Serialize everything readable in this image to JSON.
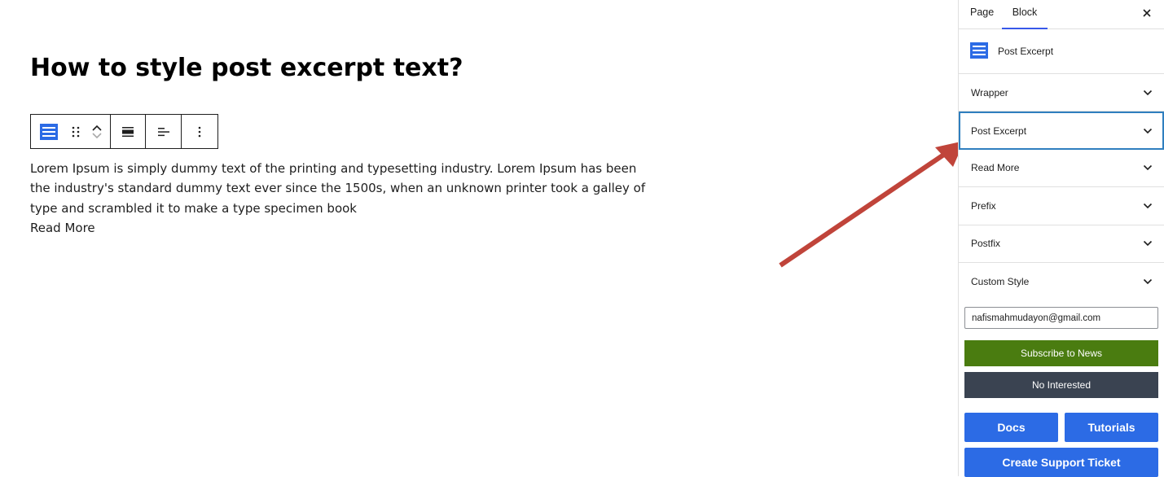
{
  "post": {
    "title": "How to style post excerpt text?",
    "excerpt": "Lorem Ipsum is simply dummy text of the printing and typesetting industry. Lorem Ipsum has been the industry's standard dummy text ever since the 1500s, when an unknown printer took a galley of type and scrambled it to make a type specimen book",
    "read_more": "Read More"
  },
  "toolbar": {
    "icons": [
      "post-excerpt-block-icon",
      "drag-handle-icon",
      "move-up-icon",
      "move-down-icon",
      "align-icon",
      "text-align-left-icon",
      "more-options-icon"
    ]
  },
  "sidebar": {
    "tabs": [
      {
        "label": "Page",
        "active": false
      },
      {
        "label": "Block",
        "active": true
      }
    ],
    "block_card": {
      "title": "Post Excerpt"
    },
    "panels": [
      {
        "label": "Wrapper",
        "active": false
      },
      {
        "label": "Post Excerpt",
        "active": true
      },
      {
        "label": "Read More",
        "active": false
      },
      {
        "label": "Prefix",
        "active": false
      },
      {
        "label": "Postfix",
        "active": false
      },
      {
        "label": "Custom Style",
        "active": false
      }
    ],
    "email_value": "nafismahmudayon@gmail.com",
    "subscribe_label": "Subscribe to News",
    "no_interest_label": "No Interested",
    "docs_label": "Docs",
    "tutorials_label": "Tutorials",
    "support_label": "Create Support Ticket"
  },
  "colors": {
    "accent_blue": "#2c6be5",
    "tab_underline": "#3858e9",
    "subscribe_green": "#4a7c10",
    "no_interest_dark": "#3a4351",
    "active_panel_border": "#2f7fbf",
    "annotation_arrow": "#c0443a"
  }
}
